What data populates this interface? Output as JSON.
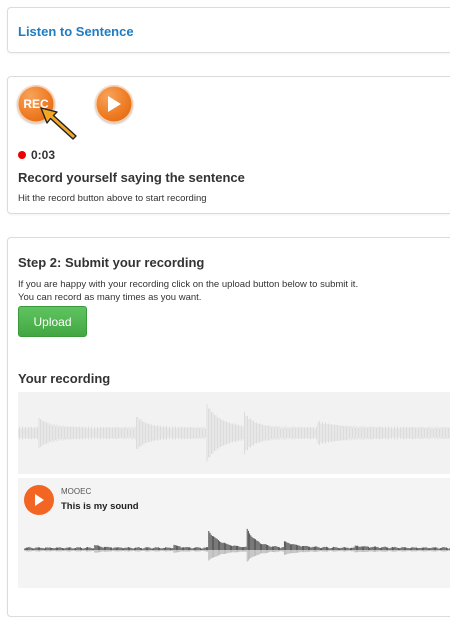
{
  "listen": {
    "label": "Listen to Sentence"
  },
  "record": {
    "rec_label": "REC",
    "timer": "0:03",
    "heading": "Record yourself saying the sentence",
    "instruction": "Hit the record button above to start recording"
  },
  "submit": {
    "heading": "Step 2: Submit your recording",
    "line1": "If you are happy with your recording click on the upload button below to submit it.",
    "line2": "You can record as many times as you want.",
    "upload_label": "Upload",
    "your_recording": "Your recording"
  },
  "player": {
    "artist": "MOOEC",
    "title": "This is my sound"
  },
  "colors": {
    "accent_orange": "#ee7a22",
    "link_blue": "#1f7cc1",
    "upload_green": "#4cae4c",
    "record_dot": "#ee0000",
    "player_orange": "#f26522"
  },
  "icons": {
    "rec": "rec-icon",
    "play": "play-icon",
    "cursor": "mouse-cursor-icon",
    "dot": "recording-dot-icon"
  }
}
